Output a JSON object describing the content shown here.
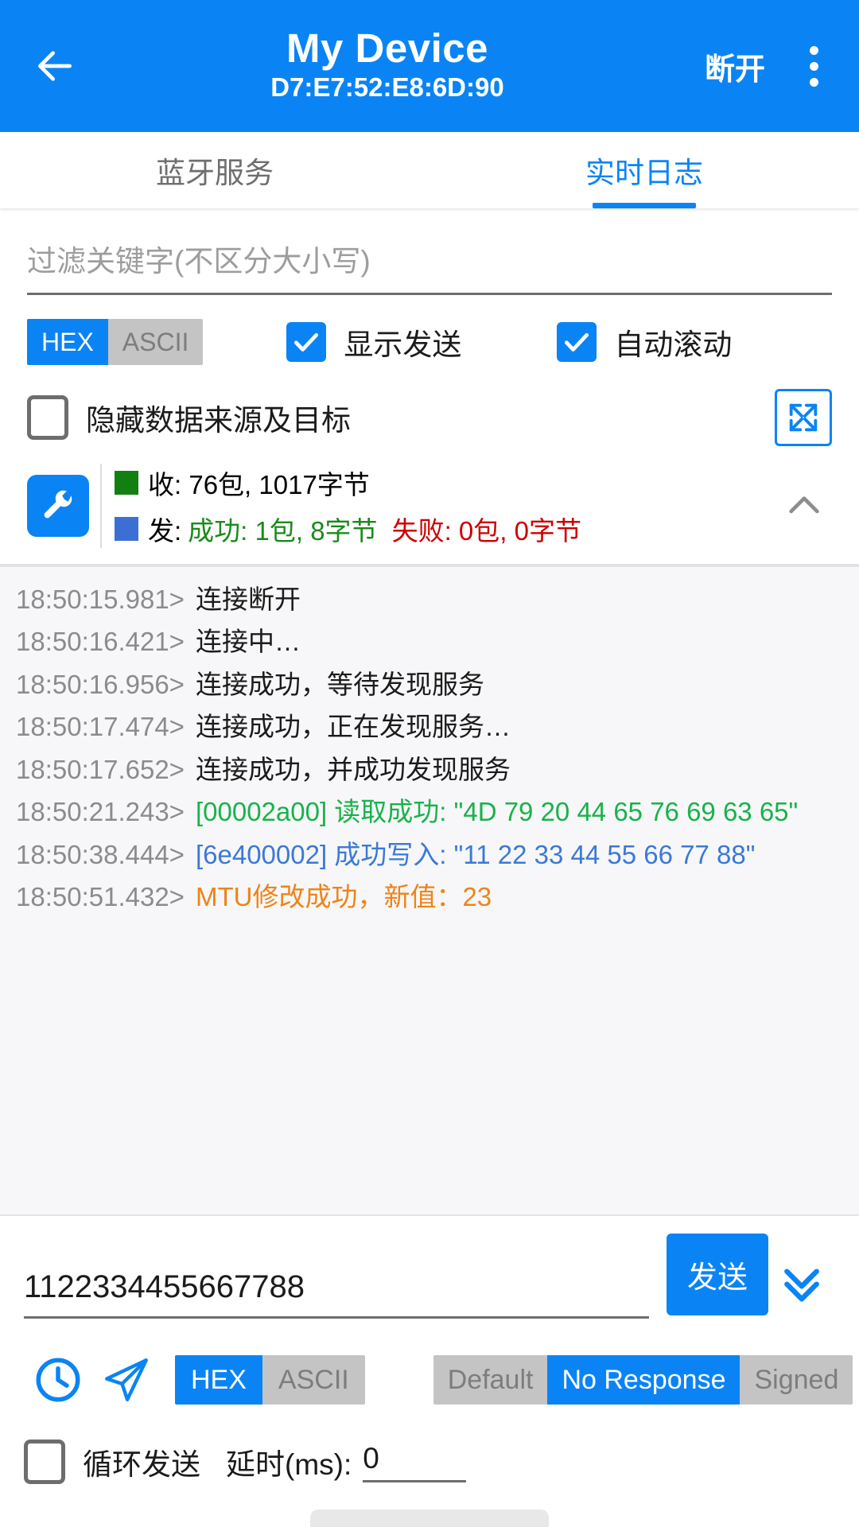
{
  "header": {
    "back_icon": "arrow-left-icon",
    "title": "My Device",
    "mac": "D7:E7:52:E8:6D:90",
    "disconnect_label": "断开",
    "menu_icon": "kebab-menu-icon",
    "bg_color": "#0a84f5"
  },
  "tabs": [
    {
      "label": "蓝牙服务",
      "active": false
    },
    {
      "label": "实时日志",
      "active": true
    }
  ],
  "filter": {
    "placeholder": "过滤关键字(不区分大小写)",
    "value": ""
  },
  "format_toggle": {
    "options": [
      "HEX",
      "ASCII"
    ],
    "selected": "HEX"
  },
  "checkboxes": {
    "show_send": {
      "label": "显示发送",
      "checked": true
    },
    "auto_scroll": {
      "label": "自动滚动",
      "checked": true
    },
    "hide_source_target": {
      "label": "隐藏数据来源及目标",
      "checked": false
    }
  },
  "expand_button": {
    "icon": "fullscreen-expand-icon"
  },
  "stats": {
    "tool_icon": "wrench-icon",
    "collapse_icon": "chevron-up-icon",
    "rx_swatch_color": "#118011",
    "tx_swatch_color": "#3b6fd4",
    "rx_text": "收: 76包, 1017字节",
    "tx_prefix": "发:",
    "tx_success": "成功: 1包, 8字节",
    "tx_fail": "失败: 0包, 0字节",
    "success_color": "#1a8a1a",
    "fail_color": "#cc0000"
  },
  "log_lines": [
    {
      "time": "18:50:15.981>",
      "text": "连接断开",
      "color": "default"
    },
    {
      "time": "18:50:16.421>",
      "text": "连接中…",
      "color": "default"
    },
    {
      "time": "18:50:16.956>",
      "text": "连接成功，等待发现服务",
      "color": "default"
    },
    {
      "time": "18:50:17.474>",
      "text": "连接成功，正在发现服务…",
      "color": "default"
    },
    {
      "time": "18:50:17.652>",
      "text": "连接成功，并成功发现服务",
      "color": "default"
    },
    {
      "time": "18:50:21.243>",
      "text": "[00002a00] 读取成功: \"4D 79 20 44 65 76 69 63 65\"",
      "color": "green"
    },
    {
      "time": "18:50:38.444>",
      "text": "[6e400002] 成功写入: \"11 22 33 44 55 66 77 88\"",
      "color": "blue"
    },
    {
      "time": "18:50:51.432>",
      "text": "MTU修改成功，新值：23",
      "color": "orange"
    }
  ],
  "send": {
    "input_value": "1122334455667788",
    "input_placeholder": "",
    "send_label": "发送",
    "expand_icon": "double-chevron-down-icon",
    "history_icon": "clock-icon",
    "quick_send_icon": "paper-plane-icon",
    "format_toggle": {
      "options": [
        "HEX",
        "ASCII"
      ],
      "selected": "HEX"
    },
    "write_mode": {
      "options": [
        "Default",
        "No Response",
        "Signed"
      ],
      "selected": "No Response"
    },
    "loop_send": {
      "label": "循环发送",
      "checked": false
    },
    "delay_label": "延时(ms):",
    "delay_value": "0"
  }
}
